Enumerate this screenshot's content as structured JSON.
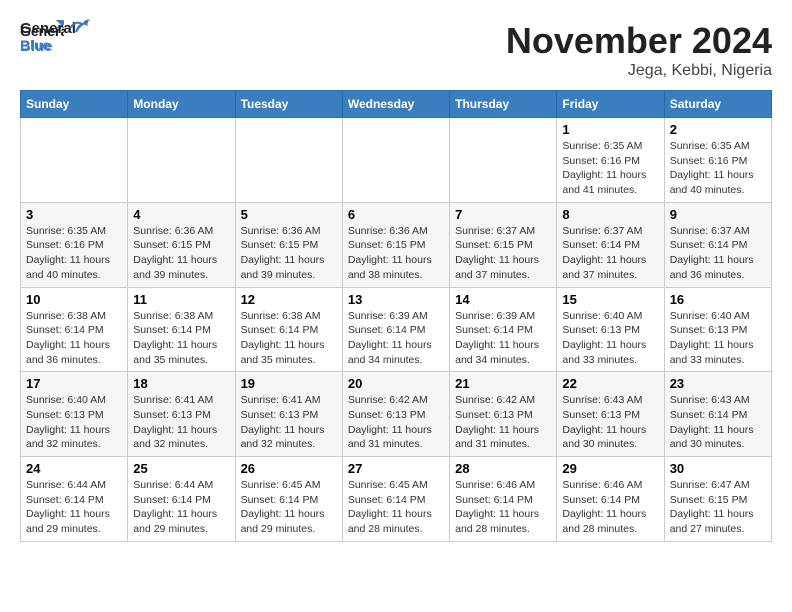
{
  "logo": {
    "general": "General",
    "blue": "Blue"
  },
  "title": "November 2024",
  "location": "Jega, Kebbi, Nigeria",
  "days_of_week": [
    "Sunday",
    "Monday",
    "Tuesday",
    "Wednesday",
    "Thursday",
    "Friday",
    "Saturday"
  ],
  "weeks": [
    [
      {
        "day": "",
        "info": ""
      },
      {
        "day": "",
        "info": ""
      },
      {
        "day": "",
        "info": ""
      },
      {
        "day": "",
        "info": ""
      },
      {
        "day": "",
        "info": ""
      },
      {
        "day": "1",
        "info": "Sunrise: 6:35 AM\nSunset: 6:16 PM\nDaylight: 11 hours and 41 minutes."
      },
      {
        "day": "2",
        "info": "Sunrise: 6:35 AM\nSunset: 6:16 PM\nDaylight: 11 hours and 40 minutes."
      }
    ],
    [
      {
        "day": "3",
        "info": "Sunrise: 6:35 AM\nSunset: 6:16 PM\nDaylight: 11 hours and 40 minutes."
      },
      {
        "day": "4",
        "info": "Sunrise: 6:36 AM\nSunset: 6:15 PM\nDaylight: 11 hours and 39 minutes."
      },
      {
        "day": "5",
        "info": "Sunrise: 6:36 AM\nSunset: 6:15 PM\nDaylight: 11 hours and 39 minutes."
      },
      {
        "day": "6",
        "info": "Sunrise: 6:36 AM\nSunset: 6:15 PM\nDaylight: 11 hours and 38 minutes."
      },
      {
        "day": "7",
        "info": "Sunrise: 6:37 AM\nSunset: 6:15 PM\nDaylight: 11 hours and 37 minutes."
      },
      {
        "day": "8",
        "info": "Sunrise: 6:37 AM\nSunset: 6:14 PM\nDaylight: 11 hours and 37 minutes."
      },
      {
        "day": "9",
        "info": "Sunrise: 6:37 AM\nSunset: 6:14 PM\nDaylight: 11 hours and 36 minutes."
      }
    ],
    [
      {
        "day": "10",
        "info": "Sunrise: 6:38 AM\nSunset: 6:14 PM\nDaylight: 11 hours and 36 minutes."
      },
      {
        "day": "11",
        "info": "Sunrise: 6:38 AM\nSunset: 6:14 PM\nDaylight: 11 hours and 35 minutes."
      },
      {
        "day": "12",
        "info": "Sunrise: 6:38 AM\nSunset: 6:14 PM\nDaylight: 11 hours and 35 minutes."
      },
      {
        "day": "13",
        "info": "Sunrise: 6:39 AM\nSunset: 6:14 PM\nDaylight: 11 hours and 34 minutes."
      },
      {
        "day": "14",
        "info": "Sunrise: 6:39 AM\nSunset: 6:14 PM\nDaylight: 11 hours and 34 minutes."
      },
      {
        "day": "15",
        "info": "Sunrise: 6:40 AM\nSunset: 6:13 PM\nDaylight: 11 hours and 33 minutes."
      },
      {
        "day": "16",
        "info": "Sunrise: 6:40 AM\nSunset: 6:13 PM\nDaylight: 11 hours and 33 minutes."
      }
    ],
    [
      {
        "day": "17",
        "info": "Sunrise: 6:40 AM\nSunset: 6:13 PM\nDaylight: 11 hours and 32 minutes."
      },
      {
        "day": "18",
        "info": "Sunrise: 6:41 AM\nSunset: 6:13 PM\nDaylight: 11 hours and 32 minutes."
      },
      {
        "day": "19",
        "info": "Sunrise: 6:41 AM\nSunset: 6:13 PM\nDaylight: 11 hours and 32 minutes."
      },
      {
        "day": "20",
        "info": "Sunrise: 6:42 AM\nSunset: 6:13 PM\nDaylight: 11 hours and 31 minutes."
      },
      {
        "day": "21",
        "info": "Sunrise: 6:42 AM\nSunset: 6:13 PM\nDaylight: 11 hours and 31 minutes."
      },
      {
        "day": "22",
        "info": "Sunrise: 6:43 AM\nSunset: 6:13 PM\nDaylight: 11 hours and 30 minutes."
      },
      {
        "day": "23",
        "info": "Sunrise: 6:43 AM\nSunset: 6:14 PM\nDaylight: 11 hours and 30 minutes."
      }
    ],
    [
      {
        "day": "24",
        "info": "Sunrise: 6:44 AM\nSunset: 6:14 PM\nDaylight: 11 hours and 29 minutes."
      },
      {
        "day": "25",
        "info": "Sunrise: 6:44 AM\nSunset: 6:14 PM\nDaylight: 11 hours and 29 minutes."
      },
      {
        "day": "26",
        "info": "Sunrise: 6:45 AM\nSunset: 6:14 PM\nDaylight: 11 hours and 29 minutes."
      },
      {
        "day": "27",
        "info": "Sunrise: 6:45 AM\nSunset: 6:14 PM\nDaylight: 11 hours and 28 minutes."
      },
      {
        "day": "28",
        "info": "Sunrise: 6:46 AM\nSunset: 6:14 PM\nDaylight: 11 hours and 28 minutes."
      },
      {
        "day": "29",
        "info": "Sunrise: 6:46 AM\nSunset: 6:14 PM\nDaylight: 11 hours and 28 minutes."
      },
      {
        "day": "30",
        "info": "Sunrise: 6:47 AM\nSunset: 6:15 PM\nDaylight: 11 hours and 27 minutes."
      }
    ]
  ]
}
